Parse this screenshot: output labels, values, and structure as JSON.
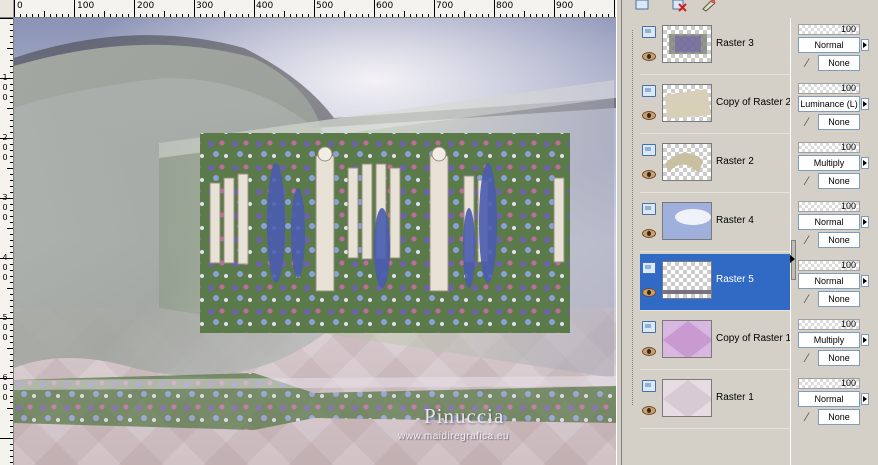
{
  "ruler": {
    "top_labels": [
      "0",
      "100",
      "200",
      "300",
      "400",
      "500",
      "600",
      "700",
      "800",
      "900"
    ],
    "left_labels": [
      "1",
      "0",
      "0",
      "2",
      "0",
      "0",
      "3",
      "0",
      "0",
      "4",
      "0",
      "0",
      "5",
      "0",
      "0",
      "6",
      "0",
      "0"
    ]
  },
  "canvas": {
    "watermark_title": "Pinuccia",
    "watermark_url": "www.maidiregrafica.eu"
  },
  "layers": {
    "toolbar_icons": [
      "new-layer-icon",
      "delete-layer-icon",
      "layer-properties-icon"
    ],
    "items": [
      {
        "name": "Raster 3",
        "opacity": "100",
        "blend": "Normal",
        "mask": "None",
        "selected": false
      },
      {
        "name": "Copy of Raster 2",
        "opacity": "100",
        "blend": "Luminance (L)",
        "mask": "None",
        "selected": false
      },
      {
        "name": "Raster 2",
        "opacity": "100",
        "blend": "Multiply",
        "mask": "None",
        "selected": false
      },
      {
        "name": "Raster 4",
        "opacity": "100",
        "blend": "Normal",
        "mask": "None",
        "selected": false
      },
      {
        "name": "Raster 5",
        "opacity": "100",
        "blend": "Normal",
        "mask": "None",
        "selected": true
      },
      {
        "name": "Copy of Raster 1",
        "opacity": "100",
        "blend": "Multiply",
        "mask": "None",
        "selected": false
      },
      {
        "name": "Raster 1",
        "opacity": "100",
        "blend": "Normal",
        "mask": "None",
        "selected": false
      }
    ]
  },
  "colors": {
    "selection": "#316ac5",
    "panel": "#d4d0c8"
  }
}
